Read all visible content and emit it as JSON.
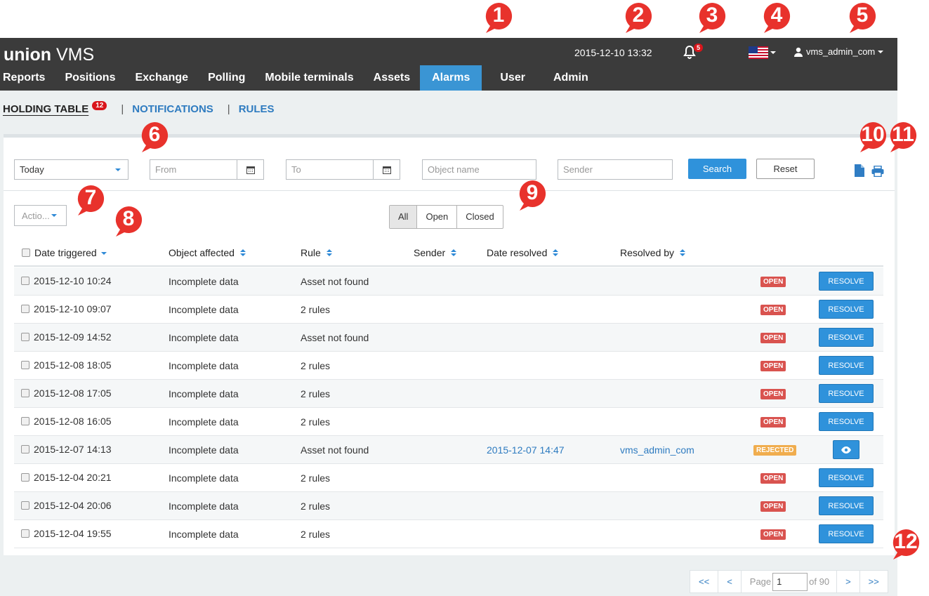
{
  "markers": [
    "1",
    "2",
    "3",
    "4",
    "5",
    "6",
    "7",
    "8",
    "9",
    "10",
    "11",
    "12"
  ],
  "header": {
    "brand_bold": "union",
    "brand_light": "VMS",
    "datetime": "2015-12-10 13:32",
    "notification_count": "5",
    "user": "vms_admin_com",
    "nav": [
      "Reports",
      "Positions",
      "Exchange",
      "Polling",
      "Mobile terminals",
      "Assets",
      "Alarms",
      "User",
      "Admin"
    ],
    "active_nav": "Alarms"
  },
  "subtabs": {
    "holding": "HOLDING TABLE",
    "holding_count": "12",
    "notifications": "NOTIFICATIONS",
    "rules": "RULES",
    "separator": "|"
  },
  "filters": {
    "period": "Today",
    "from_placeholder": "From",
    "to_placeholder": "To",
    "object_placeholder": "Object name",
    "sender_placeholder": "Sender",
    "search": "Search",
    "reset": "Reset"
  },
  "actions_label": "Actio...",
  "status_filter": [
    "All",
    "Open",
    "Closed"
  ],
  "columns": [
    "Date triggered",
    "Object affected",
    "Rule",
    "Sender",
    "Date resolved",
    "Resolved by"
  ],
  "rows": [
    {
      "date": "2015-12-10 10:24",
      "object": "Incomplete data",
      "rule": "Asset not found",
      "date_resolved": "",
      "resolved_by": "",
      "status": "OPEN",
      "action": "RESOLVE"
    },
    {
      "date": "2015-12-10 09:07",
      "object": "Incomplete data",
      "rule": "2 rules",
      "date_resolved": "",
      "resolved_by": "",
      "status": "OPEN",
      "action": "RESOLVE"
    },
    {
      "date": "2015-12-09 14:52",
      "object": "Incomplete data",
      "rule": "Asset not found",
      "date_resolved": "",
      "resolved_by": "",
      "status": "OPEN",
      "action": "RESOLVE"
    },
    {
      "date": "2015-12-08 18:05",
      "object": "Incomplete data",
      "rule": "2 rules",
      "date_resolved": "",
      "resolved_by": "",
      "status": "OPEN",
      "action": "RESOLVE"
    },
    {
      "date": "2015-12-08 17:05",
      "object": "Incomplete data",
      "rule": "2 rules",
      "date_resolved": "",
      "resolved_by": "",
      "status": "OPEN",
      "action": "RESOLVE"
    },
    {
      "date": "2015-12-08 16:05",
      "object": "Incomplete data",
      "rule": "2 rules",
      "date_resolved": "",
      "resolved_by": "",
      "status": "OPEN",
      "action": "RESOLVE"
    },
    {
      "date": "2015-12-07 14:13",
      "object": "Incomplete data",
      "rule": "Asset not found",
      "date_resolved": "2015-12-07 14:47",
      "resolved_by": "vms_admin_com",
      "status": "REJECTED",
      "action": "view"
    },
    {
      "date": "2015-12-04 20:21",
      "object": "Incomplete data",
      "rule": "2 rules",
      "date_resolved": "",
      "resolved_by": "",
      "status": "OPEN",
      "action": "RESOLVE"
    },
    {
      "date": "2015-12-04 20:06",
      "object": "Incomplete data",
      "rule": "2 rules",
      "date_resolved": "",
      "resolved_by": "",
      "status": "OPEN",
      "action": "RESOLVE"
    },
    {
      "date": "2015-12-04 19:55",
      "object": "Incomplete data",
      "rule": "2 rules",
      "date_resolved": "",
      "resolved_by": "",
      "status": "OPEN",
      "action": "RESOLVE"
    }
  ],
  "pagination": {
    "first": "<<",
    "prev": "<",
    "page_label": "Page",
    "page_value": "1",
    "of_label": "of 90",
    "next": ">",
    "last": ">>"
  },
  "colors": {
    "accent": "#3a95d4",
    "header_bg": "#3b3b3b",
    "badge_red": "#d9151b",
    "marker_red": "#e8322c"
  }
}
